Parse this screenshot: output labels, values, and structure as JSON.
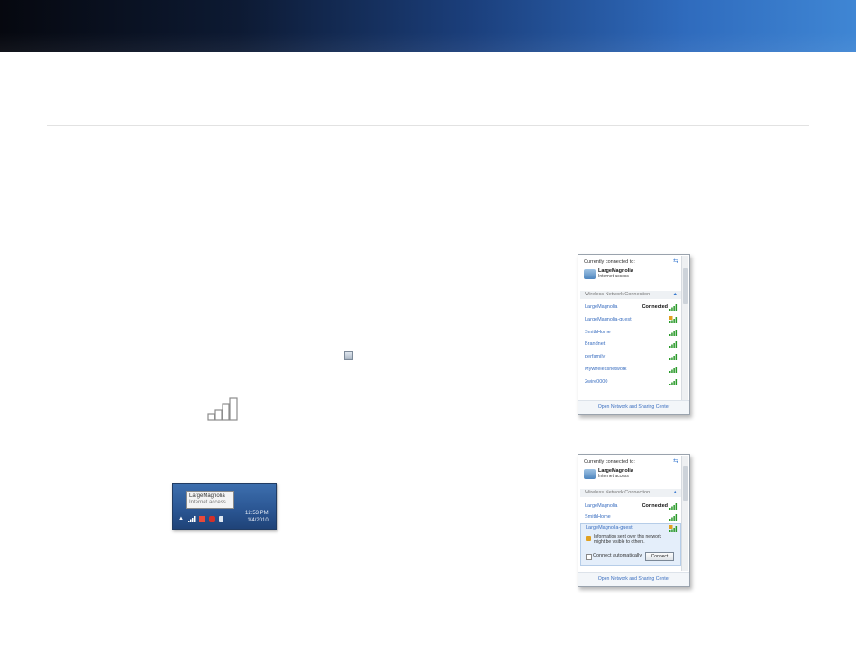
{
  "inline_icon": "network-tray-icon",
  "big_signal_icon": "signal-bars-icon",
  "taskbar": {
    "tooltip_title": "LargeMagnolia",
    "tooltip_sub": "Internet access",
    "time": "12:53 PM",
    "date": "1/4/2010",
    "tray_icons": [
      "up-arrow-icon",
      "signal-bars-icon",
      "flag-icon",
      "shield-icon",
      "speaker-icon"
    ]
  },
  "popup1": {
    "currently": "Currently connected to:",
    "connected_name": "LargeMagnolia",
    "connected_sub": "Internet access",
    "section": "Wireless Network Connection",
    "networks": [
      {
        "name": "LargeMagnolia",
        "status": "Connected"
      },
      {
        "name": "LargeMagnolia-guest",
        "status": ""
      },
      {
        "name": "SmithHome",
        "status": ""
      },
      {
        "name": "Brandnet",
        "status": ""
      },
      {
        "name": "perfamily",
        "status": ""
      },
      {
        "name": "Mywirelessnetwork",
        "status": ""
      },
      {
        "name": "2wire0000",
        "status": ""
      }
    ],
    "footer": "Open Network and Sharing Center"
  },
  "popup2": {
    "currently": "Currently connected to:",
    "connected_name": "LargeMagnolia",
    "connected_sub": "Internet access",
    "section": "Wireless Network Connection",
    "networks": [
      {
        "name": "LargeMagnolia",
        "status": "Connected"
      },
      {
        "name": "SmithHome",
        "status": ""
      }
    ],
    "selected": {
      "name": "LargeMagnolia-guest",
      "warning": "Information sent over this network might be visible to others.",
      "auto_label": "Connect automatically",
      "connect_label": "Connect"
    },
    "footer": "Open Network and Sharing Center"
  }
}
